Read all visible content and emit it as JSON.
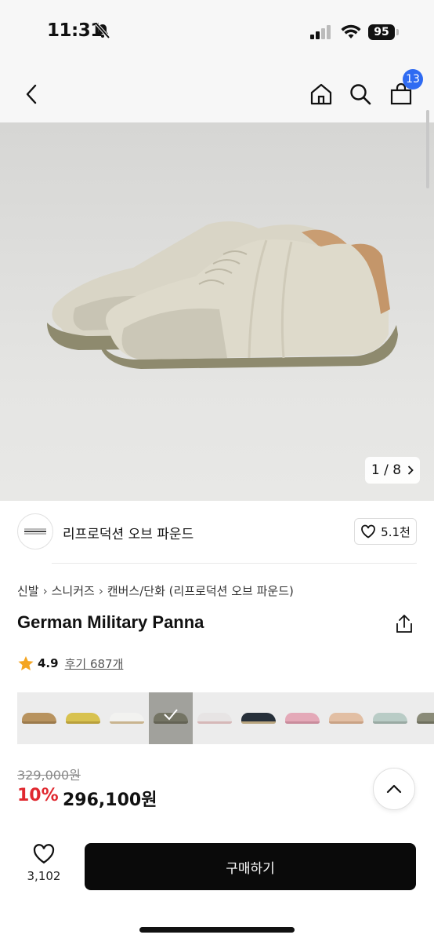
{
  "status": {
    "time": "11:31",
    "battery": "95"
  },
  "nav": {
    "cart_count": "13"
  },
  "gallery": {
    "counter": "1 / 8"
  },
  "brand": {
    "name": "리프로덕션 오브 파운드",
    "likes": "5.1천"
  },
  "breadcrumb": [
    "신발",
    "스니커즈",
    "캔버스/단화 (리프로덕션 오브 파운드)"
  ],
  "product": {
    "title": "German Military Panna",
    "rating": "4.9",
    "reviews": "후기 687개"
  },
  "swatches": [
    {
      "color": "#b8935f",
      "sole": "#9c7a4c"
    },
    {
      "color": "#d8c24f",
      "sole": "#b9a03c"
    },
    {
      "color": "#f2f2f0",
      "sole": "#c9b48f"
    },
    {
      "color": "#9a9a86",
      "sole": "#7d7b6a"
    },
    {
      "color": "#e7e4e4",
      "sole": "#d6b8b8"
    },
    {
      "color": "#27303a",
      "sole": "#b9a57f"
    },
    {
      "color": "#e4a9b8",
      "sole": "#c98c9c"
    },
    {
      "color": "#e2bfa4",
      "sole": "#c9a285"
    },
    {
      "color": "#b9ccc6",
      "sole": "#99aaa3"
    },
    {
      "color": "#8a8b78",
      "sole": "#6f705f"
    }
  ],
  "price": {
    "original": "329,000원",
    "discount": "10%",
    "final": "296,100원"
  },
  "bottom": {
    "wish_count": "3,102",
    "buy_label": "구매하기"
  }
}
